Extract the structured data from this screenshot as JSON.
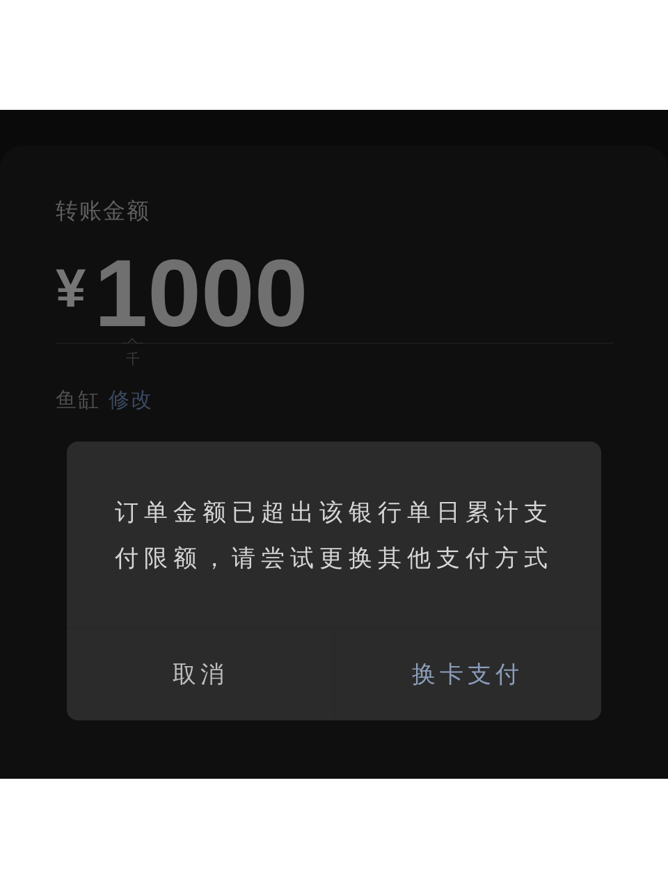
{
  "transfer": {
    "label": "转账金额",
    "amount": {
      "currency": "¥",
      "value": "1000",
      "unit_hint": "千"
    },
    "account": {
      "name": "鱼缸",
      "change_link": "修改"
    }
  },
  "dialog": {
    "message": "订单金额已超出该银行单日累计支付限额，请尝试更换其他支付方式",
    "buttons": [
      {
        "label": "取消",
        "kind": "cancel"
      },
      {
        "label": "换卡支付",
        "kind": "primary"
      }
    ]
  }
}
